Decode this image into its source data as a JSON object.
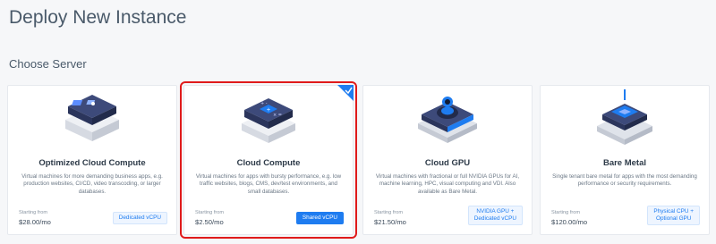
{
  "page_title": "Deploy New Instance",
  "section_title": "Choose Server",
  "colors": {
    "accent": "#1e7cf0",
    "highlight_box": "#e01b1b"
  },
  "cards": [
    {
      "title": "Optimized Cloud Compute",
      "description": "Virtual machines for more demanding business apps, e.g. production websites, CI/CD, video transcoding, or larger databases.",
      "price_label": "Starting from",
      "price": "$28.00/mo",
      "badge": "Dedicated vCPU",
      "selected": false,
      "icon": "server-stack-icon"
    },
    {
      "title": "Cloud Compute",
      "description": "Virtual machines for apps with bursty performance, e.g. low traffic websites, blogs, CMS, dev/test environments, and small databases.",
      "price_label": "Starting from",
      "price": "$2.50/mo",
      "badge": "Shared vCPU",
      "selected": true,
      "icon": "server-stack-icon"
    },
    {
      "title": "Cloud GPU",
      "description": "Virtual machines with fractional or full NVIDIA GPUs for AI, machine learning, HPC, visual computing and VDI. Also available as Bare Metal.",
      "price_label": "Starting from",
      "price": "$21.50/mo",
      "badge_line1": "NVIDIA GPU +",
      "badge_line2": "Dedicated vCPU",
      "selected": false,
      "icon": "gpu-icon"
    },
    {
      "title": "Bare Metal",
      "description": "Single tenant bare metal for apps with the most demanding performance or security requirements.",
      "price_label": "Starting from",
      "price": "$120.00/mo",
      "badge_line1": "Physical CPU +",
      "badge_line2": "Optional GPU",
      "selected": false,
      "icon": "chip-icon"
    }
  ]
}
